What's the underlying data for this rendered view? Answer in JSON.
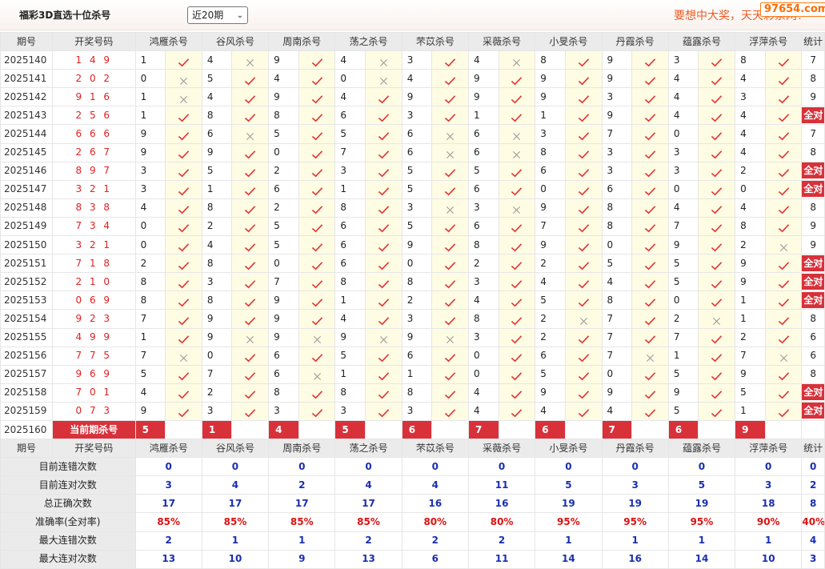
{
  "header": {
    "title": "福彩3D直选十位杀号",
    "period_select": "近20期",
    "slogan": "要想中大奖，天天彩票网！",
    "logo": "97654.com"
  },
  "columns": {
    "issue": "期号",
    "draw": "开奖号码",
    "stat": "统计",
    "experts": [
      "鸿雁杀号",
      "谷风杀号",
      "周南杀号",
      "荡之杀号",
      "芣苡杀号",
      "采薇杀号",
      "小旻杀号",
      "丹霞杀号",
      "蕴露杀号",
      "浮萍杀号"
    ]
  },
  "rows": [
    {
      "issue": "2025140",
      "draw": "1 4 9",
      "kills": [
        1,
        4,
        9,
        4,
        3,
        4,
        8,
        9,
        3,
        8
      ],
      "stat": "7"
    },
    {
      "issue": "2025141",
      "draw": "2 0 2",
      "kills": [
        0,
        5,
        4,
        0,
        4,
        9,
        9,
        9,
        4,
        4
      ],
      "stat": "8"
    },
    {
      "issue": "2025142",
      "draw": "9 1 6",
      "kills": [
        1,
        4,
        9,
        4,
        9,
        9,
        9,
        3,
        4,
        3
      ],
      "stat": "9"
    },
    {
      "issue": "2025143",
      "draw": "2 5 6",
      "kills": [
        1,
        8,
        8,
        6,
        3,
        1,
        1,
        9,
        4,
        4
      ],
      "stat": "全对"
    },
    {
      "issue": "2025144",
      "draw": "6 6 6",
      "kills": [
        9,
        6,
        5,
        5,
        6,
        6,
        3,
        7,
        0,
        4
      ],
      "stat": "7"
    },
    {
      "issue": "2025145",
      "draw": "2 6 7",
      "kills": [
        9,
        9,
        0,
        7,
        6,
        6,
        8,
        3,
        3,
        4
      ],
      "stat": "8"
    },
    {
      "issue": "2025146",
      "draw": "8 9 7",
      "kills": [
        3,
        5,
        2,
        3,
        5,
        5,
        6,
        3,
        3,
        2
      ],
      "stat": "全对"
    },
    {
      "issue": "2025147",
      "draw": "3 2 1",
      "kills": [
        3,
        1,
        6,
        1,
        5,
        6,
        0,
        6,
        0,
        0
      ],
      "stat": "全对"
    },
    {
      "issue": "2025148",
      "draw": "8 3 8",
      "kills": [
        4,
        8,
        2,
        8,
        3,
        3,
        9,
        8,
        4,
        4
      ],
      "stat": "8"
    },
    {
      "issue": "2025149",
      "draw": "7 3 4",
      "kills": [
        0,
        2,
        5,
        6,
        5,
        6,
        7,
        8,
        7,
        8
      ],
      "stat": "9"
    },
    {
      "issue": "2025150",
      "draw": "3 2 1",
      "kills": [
        0,
        4,
        5,
        6,
        9,
        8,
        9,
        0,
        9,
        2
      ],
      "stat": "9"
    },
    {
      "issue": "2025151",
      "draw": "7 1 8",
      "kills": [
        2,
        8,
        0,
        6,
        0,
        2,
        2,
        5,
        5,
        9
      ],
      "stat": "全对"
    },
    {
      "issue": "2025152",
      "draw": "2 1 0",
      "kills": [
        8,
        3,
        7,
        8,
        8,
        3,
        4,
        4,
        5,
        9
      ],
      "stat": "全对"
    },
    {
      "issue": "2025153",
      "draw": "0 6 9",
      "kills": [
        8,
        8,
        9,
        1,
        2,
        4,
        5,
        8,
        0,
        1
      ],
      "stat": "全对"
    },
    {
      "issue": "2025154",
      "draw": "9 2 3",
      "kills": [
        7,
        9,
        9,
        4,
        3,
        8,
        2,
        7,
        2,
        1
      ],
      "stat": "8"
    },
    {
      "issue": "2025155",
      "draw": "4 9 9",
      "kills": [
        1,
        9,
        9,
        9,
        9,
        3,
        2,
        7,
        7,
        2
      ],
      "stat": "6"
    },
    {
      "issue": "2025156",
      "draw": "7 7 5",
      "kills": [
        7,
        0,
        6,
        5,
        6,
        0,
        6,
        7,
        1,
        7
      ],
      "stat": "6"
    },
    {
      "issue": "2025157",
      "draw": "9 6 9",
      "kills": [
        5,
        7,
        6,
        1,
        1,
        0,
        5,
        0,
        5,
        9
      ],
      "stat": "8"
    },
    {
      "issue": "2025158",
      "draw": "7 0 1",
      "kills": [
        4,
        2,
        8,
        8,
        8,
        4,
        9,
        9,
        9,
        5
      ],
      "stat": "全对"
    },
    {
      "issue": "2025159",
      "draw": "0 7 3",
      "kills": [
        9,
        3,
        3,
        3,
        3,
        4,
        4,
        4,
        5,
        1
      ],
      "stat": "全对"
    }
  ],
  "current": {
    "issue": "2025160",
    "label": "当前期杀号",
    "kills": [
      5,
      1,
      4,
      5,
      6,
      7,
      6,
      7,
      6,
      9
    ]
  },
  "stats": [
    {
      "label": "目前连错次数",
      "values": [
        "0",
        "0",
        "0",
        "0",
        "0",
        "0",
        "0",
        "0",
        "0",
        "0"
      ],
      "total": "0"
    },
    {
      "label": "目前连对次数",
      "values": [
        "3",
        "4",
        "2",
        "4",
        "4",
        "11",
        "5",
        "3",
        "5",
        "3"
      ],
      "total": "2"
    },
    {
      "label": "总正确次数",
      "values": [
        "17",
        "17",
        "17",
        "17",
        "16",
        "16",
        "19",
        "19",
        "19",
        "18"
      ],
      "total": "8"
    },
    {
      "label": "准确率(全对率)",
      "values": [
        "85%",
        "85%",
        "85%",
        "85%",
        "80%",
        "80%",
        "95%",
        "95%",
        "95%",
        "90%"
      ],
      "total": "40%"
    },
    {
      "label": "最大连错次数",
      "values": [
        "2",
        "1",
        "1",
        "2",
        "2",
        "2",
        "1",
        "1",
        "1",
        "1"
      ],
      "total": "4"
    },
    {
      "label": "最大连对次数",
      "values": [
        "13",
        "10",
        "9",
        "13",
        "6",
        "11",
        "14",
        "16",
        "14",
        "10"
      ],
      "total": "3"
    }
  ],
  "colors": {
    "correct": "#e03a3a",
    "wrong": "#9a9a9a",
    "accent": "#d8313a",
    "stat_value": "#1a2fb0",
    "stat_rate": "#dd1111"
  }
}
